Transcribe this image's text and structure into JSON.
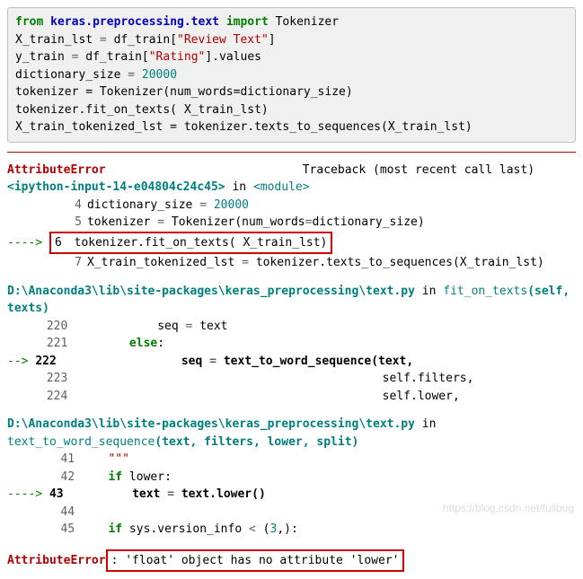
{
  "code": {
    "l1": {
      "kw1": "from",
      "mod": "keras.preprocessing.text",
      "kw2": "import",
      "name": "Tokenizer"
    },
    "l2": {
      "lhs": "X_train_lst",
      "eq": "=",
      "rhs": "df_train[",
      "str": "\"Review Text\"",
      "close": "]"
    },
    "l3": {
      "lhs": "y_train",
      "eq": "=",
      "rhs": "df_train[",
      "str": "\"Rating\"",
      "tail": "].values"
    },
    "l4": {
      "lhs": "dictionary_size",
      "eq": "=",
      "num": "20000"
    },
    "l5": {
      "text": "tokenizer = Tokenizer(num_words=dictionary_size)"
    },
    "l6": {
      "text": "tokenizer.fit_on_texts( X_train_lst)"
    },
    "l7": {
      "text": "X_train_tokenized_lst = tokenizer.texts_to_sequences(X_train_lst)"
    }
  },
  "tb": {
    "errname": "AttributeError",
    "header_tail": "Traceback (most recent call last)",
    "loc1_pre": "<ipython-input-14-e04804c24c45>",
    "loc1_in": " in ",
    "loc1_mod": "<module>",
    "l4n": "4",
    "l4": "dictionary_size ",
    "l4eq": "= ",
    "l4num": "20000",
    "l5n": "5",
    "l5a": "tokenizer ",
    "l5eq": "= ",
    "l5b": "Tokenizer(num_words",
    "l5eq2": "=",
    "l5c": "dictionary_size)",
    "arrow": "----> ",
    "l6n": "6",
    "l6": "tokenizer.fit_on_texts( X_train_lst)",
    "l7n": "7",
    "l7a": "X_train_tokenized_lst ",
    "l7eq": "= ",
    "l7b": "tokenizer.",
    "l7c": "texts_to_sequences(X_train_lst)",
    "path2a": "D:\\Anaconda3\\lib\\site-packages\\keras_preprocessing\\text.py",
    "in": " in ",
    "func2": "fit_on_texts",
    "sig2": "(self, texts)",
    "l220n": "220",
    "l220": "            seq ",
    "l220eq": "= ",
    "l220b": "text",
    "l221n": "221",
    "l221kw": "        else",
    "colon": ":",
    "arrow2": "--> ",
    "l222n": "222",
    "l222": "                seq ",
    "l222eq": "= ",
    "l222b": "text_to_word_sequence(text,",
    "l223n": "223",
    "l223": "                                            self.filters,",
    "l224n": "224",
    "l224": "                                            self.lower,",
    "path3a": "D:\\Anaconda3\\lib\\site-packages\\keras_preprocessing\\text.py",
    "func3": "text_to_word_sequence",
    "sig3": "(text, filters, lower, split)",
    "l41n": "41",
    "l41": "    \"\"\"",
    "l42n": "42",
    "l42kw": "    if",
    "l42b": " lower:",
    "arrow3": "----> ",
    "l43n": "43",
    "l43": "        text ",
    "l43eq": "= ",
    "l43b": "text.",
    "l43c": "lower()",
    "l44n": "44",
    "l45n": "45",
    "l45kw": "    if",
    "l45b": " sys.version_info ",
    "l45op": "< ",
    "l45c": "(",
    "l45num": "3",
    "l45d": ",):",
    "final_err": "AttributeError",
    "final_msg": ": 'float' object has no attribute 'lower'"
  },
  "watermark": "https://blog.csdn.net/fullbug"
}
